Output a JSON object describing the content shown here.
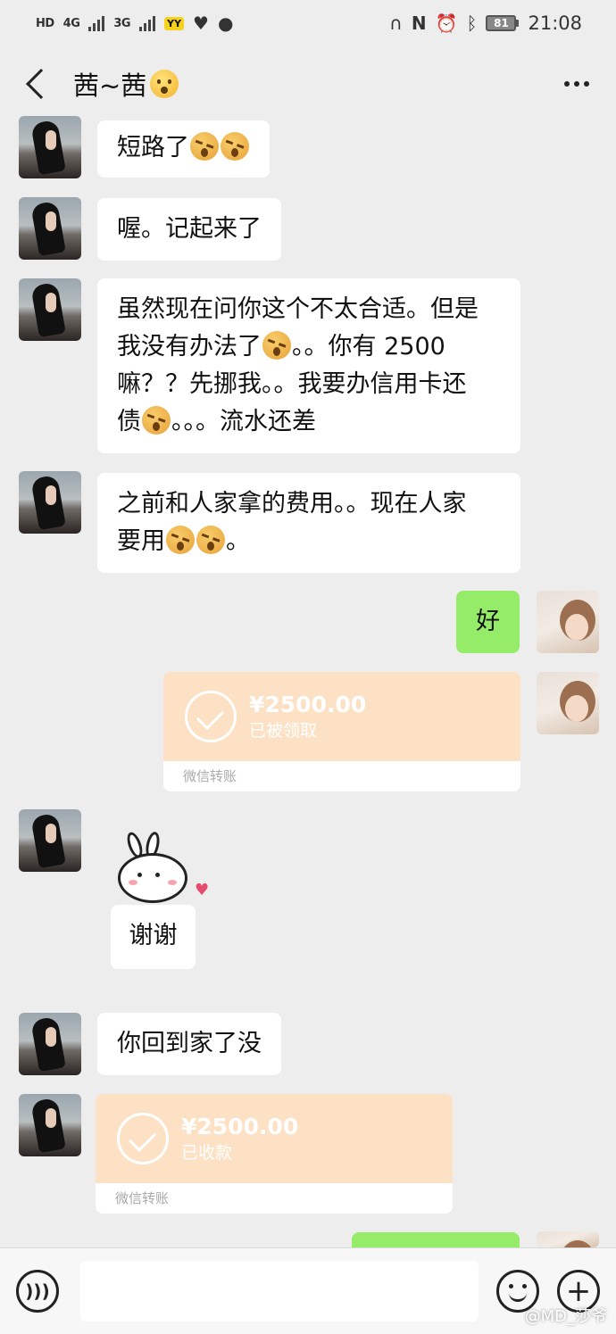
{
  "status_bar": {
    "left_chips": [
      "HD",
      "4G",
      "3G",
      "YY"
    ],
    "right_icons": [
      "headset-icon",
      "nfc-icon",
      "alarm-icon",
      "bluetooth-icon"
    ],
    "battery": "81",
    "time": "21:08"
  },
  "chat": {
    "title": "茜~茜",
    "more_label": "more"
  },
  "messages": [
    {
      "sender": "her",
      "text_parts": [
        "短路了",
        "[emoji]",
        "[emoji]"
      ]
    },
    {
      "sender": "her",
      "text": "喔。记起来了"
    },
    {
      "sender": "her",
      "lines": [
        "虽然现在问你这个不太合适。但是",
        "我没有办法了",
        "。。你有 2500",
        "嘛？？先挪我。。我要办信用卡还",
        "债",
        "。。。流水还差"
      ]
    },
    {
      "sender": "her",
      "lines": [
        "之前和人家拿的费用。。现在人家",
        "要用",
        "。"
      ]
    },
    {
      "sender": "me",
      "text": "好"
    },
    {
      "sender": "me",
      "transfer": {
        "amount": "¥2500.00",
        "status": "已被领取",
        "label": "微信转账"
      }
    },
    {
      "sender": "her",
      "sticker_caption": "谢谢"
    },
    {
      "sender": "her",
      "text": "你回到家了没"
    },
    {
      "sender": "her",
      "transfer": {
        "amount": "¥2500.00",
        "status": "已收款",
        "label": "微信转账"
      }
    }
  ],
  "input_bar": {
    "placeholder": ""
  },
  "watermark": "@MD_莎爷",
  "colors": {
    "background": "#ededed",
    "my_bubble": "#95ec69",
    "transfer_card": "#fde1c4"
  }
}
